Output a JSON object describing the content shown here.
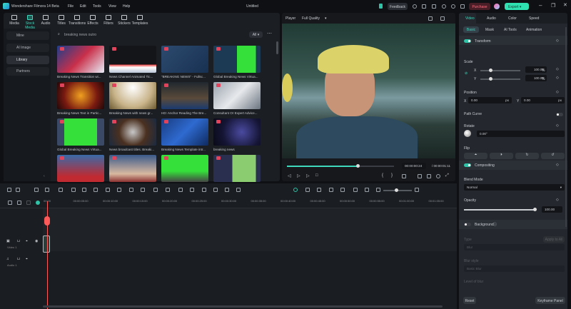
{
  "app": {
    "title": "Wondershare Filmora 14 Beta",
    "project": "Untitled",
    "menu": [
      "File",
      "Edit",
      "Tools",
      "View",
      "Help"
    ],
    "feedback": "Feedback",
    "purchase": "Purchase",
    "export": "Export"
  },
  "media_tabs": [
    {
      "label": "Media",
      "icon": "media-icon"
    },
    {
      "label": "Stock Media",
      "icon": "stock-media-icon",
      "active": true
    },
    {
      "label": "Audio",
      "icon": "audio-icon"
    },
    {
      "label": "Titles",
      "icon": "titles-icon"
    },
    {
      "label": "Transitions",
      "icon": "transitions-icon"
    },
    {
      "label": "Effects",
      "icon": "effects-icon"
    },
    {
      "label": "Filters",
      "icon": "filters-icon"
    },
    {
      "label": "Stickers",
      "icon": "stickers-icon"
    },
    {
      "label": "Templates",
      "icon": "templates-icon"
    }
  ],
  "sidebar": [
    {
      "label": "Mine"
    },
    {
      "label": "AI Image"
    },
    {
      "label": "Library",
      "selected": true
    },
    {
      "label": "Partners"
    }
  ],
  "search": {
    "value": "breaking news outro",
    "filter": "All"
  },
  "grid": [
    {
      "label": "Breaking News Transition wi...",
      "bg": "linear-gradient(135deg,#1d3e8a,#c9304a 50%,#e8eef8)"
    },
    {
      "label": "News Channel Animated Tic...",
      "bg": "linear-gradient(#141518 70%,#e84040 70%,#fff 80%,#b8c4d6)"
    },
    {
      "label": "\"BREAKING NEWS\" - Fullsc...",
      "bg": "linear-gradient(135deg,#2d4a6e,#173152)"
    },
    {
      "label": "Global Breaking News Virtua...",
      "bg": "linear-gradient(90deg,#1d3a55 50%,#35e03a 50%,#35e03a 90%,#1d3a55 90%)"
    },
    {
      "label": "Breaking News Text in Partic...",
      "bg": "radial-gradient(circle,#f0a020,#7a1a10 60%,#200808)"
    },
    {
      "label": "Breaking News with news gr...",
      "bg": "radial-gradient(circle at 50% 20%,#fff,#c9b48a 60%,#6a5830)"
    },
    {
      "label": "HD: Anchor Reading The Bre...",
      "bg": "linear-gradient(#20282f,#5a4a3a 60%,#1a3a70)"
    },
    {
      "label": "Consultant Or Expert Advice...",
      "bg": "linear-gradient(135deg,#9aa3ad,#e7e9ec,#6b7480)"
    },
    {
      "label": "Global Breaking News Virtua...",
      "bg": "linear-gradient(90deg,#3a4a66 15%,#35e03a 15%,#35e03a 85%,#3a4a66 85%)"
    },
    {
      "label": "News broadcast titles. Breaki...",
      "bg": "radial-gradient(circle,#c8c8c8,#4a3020 50%,#1a2a40)"
    },
    {
      "label": "Breaking News Template intr...",
      "bg": "linear-gradient(135deg,#1a3c80,#2e6ad0,#0f2a60)"
    },
    {
      "label": "breaking news",
      "bg": "radial-gradient(circle at 60% 50%,#4a4aa0,#151535 60%,#0a0a18)"
    },
    {
      "label": "",
      "bg": "linear-gradient(#3a6aa8,#c02a30 80%)"
    },
    {
      "label": "",
      "bg": "linear-gradient(#3a5a8a,#d9b9a0 70%,#8a3030)"
    },
    {
      "label": "",
      "bg": "linear-gradient(#35e03a,#35e03a 60%,#444 100%)"
    },
    {
      "label": "",
      "bg": "linear-gradient(90deg,#2a2f50 40%,#8ccc70 40%,#8ccc70 90%,#2a2f50 90%)"
    }
  ],
  "player": {
    "label": "Player",
    "quality": "Full Quality",
    "current_time": "00:00:00:24",
    "total_time": "00:00:01:11",
    "progress": 0.66
  },
  "props": {
    "tabs": [
      "Video",
      "Audio",
      "Color",
      "Speed"
    ],
    "subtabs": [
      "Basic",
      "Mask",
      "AI Tools",
      "Animation"
    ],
    "transform": "Transform",
    "scale": "Scale",
    "x": "X",
    "y": "Y",
    "scale_x": "100.00",
    "scale_y": "100.00",
    "pct": "%",
    "position": "Position",
    "pos_x": "0.00",
    "pos_y": "0.00",
    "px": "px",
    "path_curve": "Path Curve",
    "rotate": "Rotate",
    "rotate_value": "0.00°",
    "flip": "Flip",
    "compositing": "Compositing",
    "blend_mode": "Blend Mode",
    "blend_value": "Normal",
    "opacity": "Opacity",
    "opacity_value": "100.00",
    "background": "Background",
    "type": "Type",
    "apply_all": "Apply to All",
    "type_value": "Blur",
    "blur_style": "Blur style",
    "blur_style_value": "Basic Blur",
    "level": "Level of blur",
    "reset": "Reset",
    "keyframe": "Keyframe Panel"
  },
  "timeline": {
    "ticks": [
      "00:00",
      "00:00:05:00",
      "00:00:10:00",
      "00:00:15:00",
      "00:00:20:00",
      "00:00:25:00",
      "00:00:30:00",
      "00:00:35:00",
      "00:00:40:00",
      "00:00:45:00",
      "00:00:50:00",
      "00:00:55:00",
      "00:01:00:00",
      "00:01:05:00"
    ],
    "video_track": "Video 1",
    "audio_track": "Audio 1"
  },
  "colors": {
    "accent": "#2fc3a8",
    "playhead": "#ff5a5a"
  }
}
